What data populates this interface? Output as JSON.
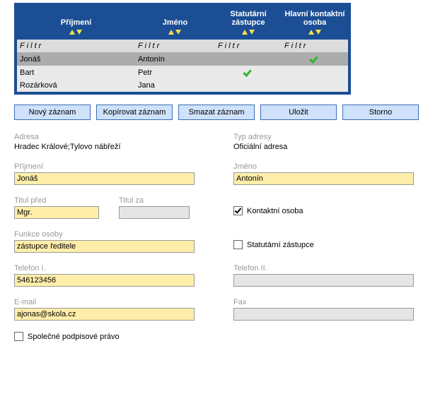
{
  "table": {
    "headers": [
      "Příjmení",
      "Jméno",
      "Statutární zástupce",
      "Hlavní kontaktní osoba"
    ],
    "filter_placeholder": "Filtr",
    "rows": [
      {
        "prijmeni": "Jonáš",
        "jmeno": "Antonín",
        "statutarni": false,
        "kontaktni": true,
        "selected": true
      },
      {
        "prijmeni": "Bart",
        "jmeno": "Petr",
        "statutarni": true,
        "kontaktni": false,
        "selected": false
      },
      {
        "prijmeni": "Rozárková",
        "jmeno": "Jana",
        "statutarni": false,
        "kontaktni": false,
        "selected": false
      }
    ]
  },
  "buttons": {
    "new": "Nový záznam",
    "copy": "Kopírovat záznam",
    "delete": "Smazat záznam",
    "save": "Uložit",
    "cancel": "Storno"
  },
  "form": {
    "adresa_label": "Adresa",
    "adresa_value": "Hradec Králové;Tylovo nábřeží",
    "typ_adresy_label": "Typ adresy",
    "typ_adresy_value": "Oficiální adresa",
    "prijmeni_label": "Příjmení",
    "prijmeni_value": "Jonáš",
    "jmeno_label": "Jméno",
    "jmeno_value": "Antonín",
    "titul_pred_label": "Titul před",
    "titul_pred_value": "Mgr.",
    "titul_za_label": "Titul za",
    "titul_za_value": "",
    "kontaktni_osoba_label": "Kontaktní osoba",
    "kontaktni_osoba_checked": true,
    "funkce_label": "Funkce osoby",
    "funkce_value": "zástupce ředitele",
    "statutarni_label": "Statutární zástupce",
    "statutarni_checked": false,
    "tel1_label": "Telefon I.",
    "tel1_value": "546123456",
    "tel2_label": "Telefon II.",
    "tel2_value": "",
    "email_label": "E-mail",
    "email_value": "ajonas@skola.cz",
    "fax_label": "Fax",
    "fax_value": "",
    "spolecne_label": "Společné podpisové právo",
    "spolecne_checked": false
  }
}
